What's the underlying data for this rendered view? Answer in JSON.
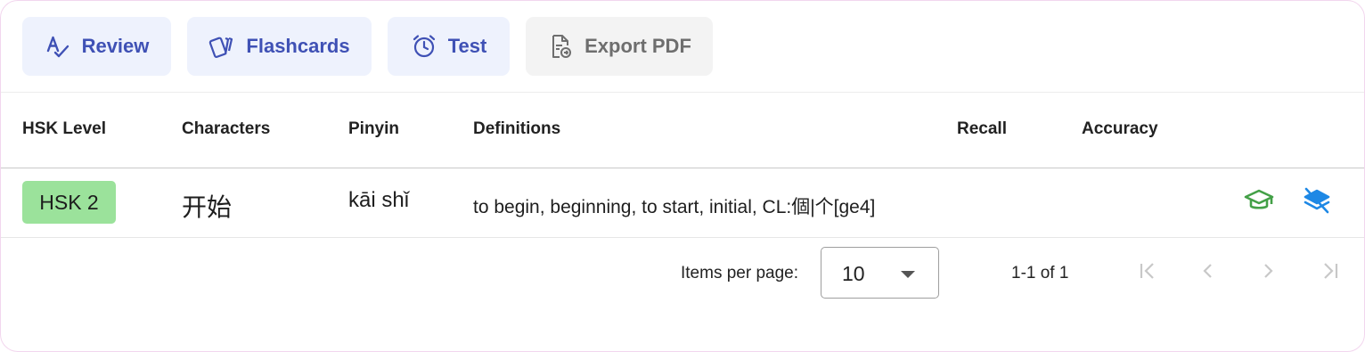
{
  "toolbar": {
    "review_label": "Review",
    "flashcards_label": "Flashcards",
    "test_label": "Test",
    "export_label": "Export PDF"
  },
  "table": {
    "headers": {
      "level": "HSK Level",
      "characters": "Characters",
      "pinyin": "Pinyin",
      "definitions": "Definitions",
      "recall": "Recall",
      "accuracy": "Accuracy"
    },
    "rows": [
      {
        "level": "HSK 2",
        "characters": "开始",
        "pinyin": "kāi shǐ",
        "definitions": "to begin, beginning, to start, initial, CL:個|个[ge4]",
        "recall": "",
        "accuracy": "",
        "actions": [
          {
            "icon": "graduation-cap-icon",
            "color": "#43a047"
          },
          {
            "icon": "layers-off-icon",
            "color": "#1e88e5"
          }
        ]
      }
    ]
  },
  "paginator": {
    "items_per_page_label": "Items per page:",
    "page_size": "10",
    "range_label": "1-1 of 1"
  },
  "colors": {
    "accent": "#3f51b5",
    "button_bg": "#eef2fd",
    "disabled_bg": "#f3f3f3",
    "badge_bg": "#9be29b"
  }
}
